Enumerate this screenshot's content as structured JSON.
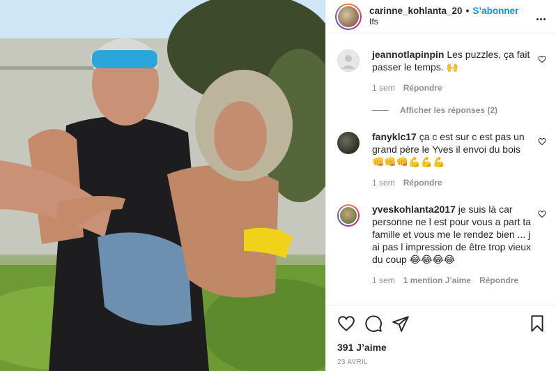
{
  "header": {
    "username": "carinne_kohlanta_20",
    "separator": "•",
    "follow_label": "S’abonner",
    "location": "Ifs",
    "more": "..."
  },
  "comments": [
    {
      "username": "jeannotlapinpin",
      "text": "Les puzzles, ça fait passer le temps. 🙌",
      "time": "1 sem",
      "reply_label": "Répondre",
      "avatar_icon": "default-avatar-icon"
    },
    {
      "username": "fanyklc17",
      "text": "ça c est sur c est pas un grand père le Yves il envoi du bois 👊👊👊💪💪💪",
      "time": "1 sem",
      "reply_label": "Répondre",
      "avatar_icon": "user-photo"
    },
    {
      "username": "yveskohlanta2017",
      "text": "je suis là car personne ne l est pour vous a part ta famille et vous me le rendez bien ... j ai pas l impression de être trop vieux du coup 😂😂😂😂",
      "time": "1 sem",
      "likes_label": "1 mention J’aime",
      "reply_label": "Répondre",
      "avatar_icon": "user-photo"
    }
  ],
  "replies_toggle": "Afficher les réponses (2)",
  "actions": {
    "icons": [
      "heart-icon",
      "comment-icon",
      "share-icon",
      "bookmark-icon"
    ],
    "likes": "391 J’aime",
    "date": "23 AVRIL"
  },
  "colors": {
    "accent": "#0095f6",
    "muted": "#8e8e8e",
    "text": "#262626",
    "border": "#efefef"
  }
}
